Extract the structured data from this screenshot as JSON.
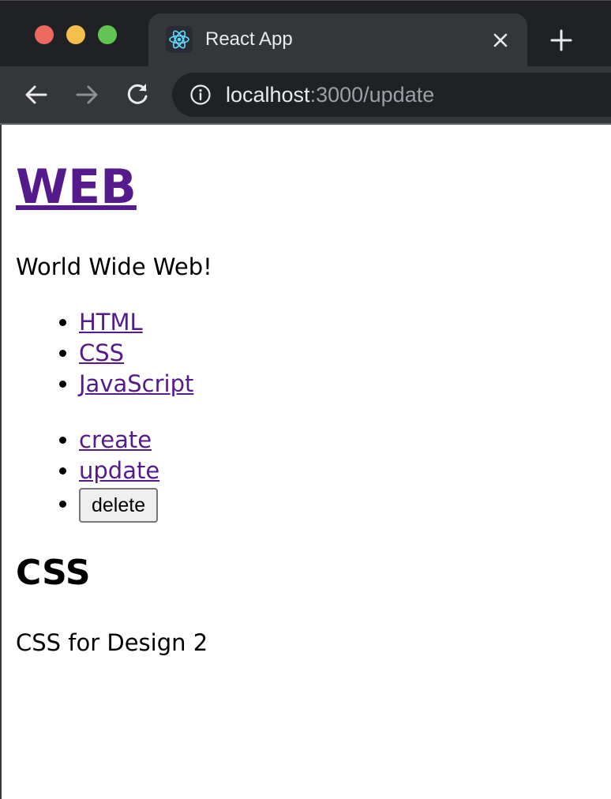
{
  "browser": {
    "tab": {
      "title": "React App",
      "favicon": "react-logo-icon"
    },
    "address_bar": {
      "host": "localhost",
      "path": ":3000/update"
    },
    "colors": {
      "chrome_dark": "#202124",
      "chrome_mid": "#35363a",
      "react_blue": "#61dafb"
    }
  },
  "page": {
    "header": {
      "title": "WEB"
    },
    "subtitle": "World Wide Web!",
    "topics": [
      {
        "label": "HTML"
      },
      {
        "label": "CSS"
      },
      {
        "label": "JavaScript"
      }
    ],
    "controls": {
      "create_label": "create",
      "update_label": "update",
      "delete_label": "delete"
    },
    "article": {
      "title": "CSS",
      "body": "CSS for Design 2"
    },
    "colors": {
      "link": "#551a8b",
      "text": "#000000"
    }
  }
}
